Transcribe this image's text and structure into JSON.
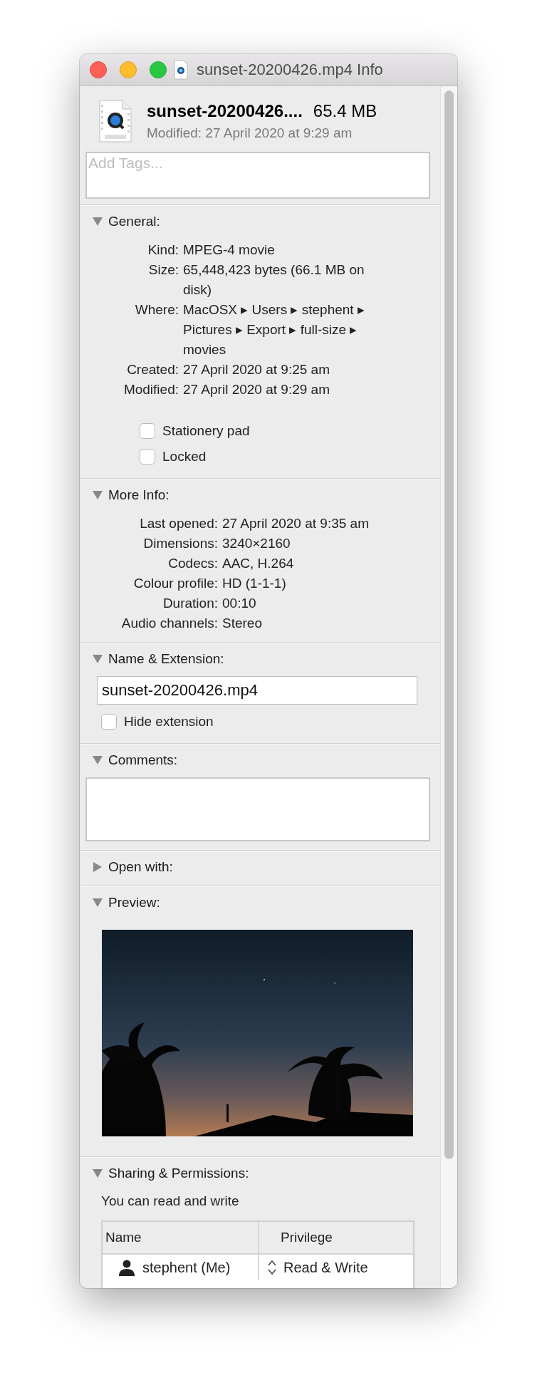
{
  "window": {
    "title": "sunset-20200426.mp4 Info"
  },
  "header": {
    "name": "sunset-20200426....",
    "size": "65.4 MB",
    "modified": "Modified: 27 April 2020 at 9:29 am"
  },
  "tags": {
    "placeholder": "Add Tags..."
  },
  "sections": [
    {
      "kind": "general",
      "title": "General:",
      "expanded": true,
      "rows": [
        {
          "label": "Kind:",
          "value": "MPEG-4 movie"
        },
        {
          "label": "Size:",
          "value": "65,448,423 bytes (66.1 MB on disk)"
        },
        {
          "label": "Where:",
          "value": "MacOSX ▸ Users ▸ stephent ▸ Pictures ▸ Export ▸ full-size ▸ movies"
        },
        {
          "label": "Created:",
          "value": "27 April 2020 at 9:25 am"
        },
        {
          "label": "Modified:",
          "value": "27 April 2020 at 9:29 am"
        }
      ],
      "checkboxes": [
        {
          "label": "Stationery pad",
          "checked": false
        },
        {
          "label": "Locked",
          "checked": false
        }
      ]
    },
    {
      "kind": "info",
      "title": "More Info:",
      "expanded": true,
      "rows": [
        {
          "label": "Last opened:",
          "value": "27 April 2020 at 9:35 am"
        },
        {
          "label": "Dimensions:",
          "value": "3240×2160"
        },
        {
          "label": "Codecs:",
          "value": "AAC, H.264"
        },
        {
          "label": "Colour profile:",
          "value": "HD (1-1-1)"
        },
        {
          "label": "Duration:",
          "value": "00:10"
        },
        {
          "label": "Audio channels:",
          "value": "Stereo"
        }
      ]
    },
    {
      "kind": "name",
      "title": "Name & Extension:",
      "expanded": true,
      "value": "sunset-20200426.mp4",
      "checkboxes": [
        {
          "label": "Hide extension",
          "checked": false
        }
      ]
    },
    {
      "kind": "comments",
      "title": "Comments:",
      "expanded": true
    },
    {
      "title": "Open with:",
      "expanded": false
    },
    {
      "kind": "preview",
      "title": "Preview:",
      "expanded": true
    },
    {
      "kind": "sharing",
      "title": "Sharing & Permissions:",
      "expanded": true,
      "note": "You can read and write",
      "columns": [
        "Name",
        "Privilege"
      ],
      "rows": [
        {
          "name": "stephent (Me)",
          "privilege": "Read & Write"
        }
      ]
    }
  ]
}
